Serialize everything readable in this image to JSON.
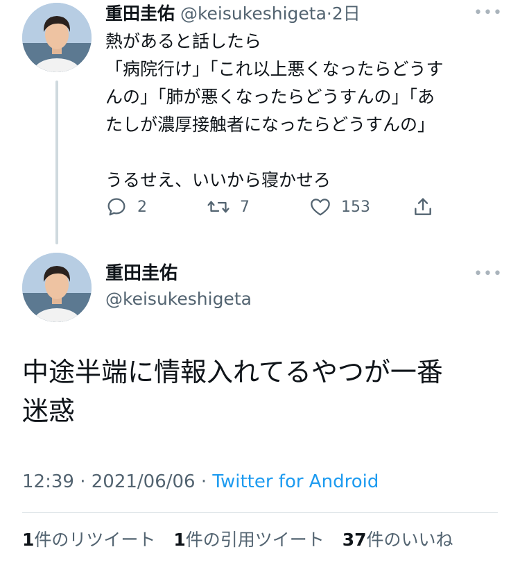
{
  "tweet1": {
    "author_name": "重田圭佑",
    "handle": "@keisukeshigeta",
    "separator": "·",
    "time_ago": "2日",
    "lines": [
      "熱があると話したら",
      "「病院行け」「これ以上悪くなったらどうす",
      "んの」「肺が悪くなったらどうすんの」「あ",
      "たしが濃厚接触者になったらどうすんの」",
      "",
      "うるせえ、いいから寝かせろ"
    ],
    "reply_count": "2",
    "retweet_count": "7",
    "like_count": "153",
    "icons": [
      "reply-icon",
      "retweet-icon",
      "like-icon",
      "share-icon",
      "more-icon"
    ]
  },
  "tweet2": {
    "author_name": "重田圭佑",
    "handle": "@keisukeshigeta",
    "lines": [
      "中途半端に情報入れてるやつが一番",
      "迷惑"
    ],
    "time": "12:39",
    "separator": "·",
    "date": "2021/06/06",
    "separator2": "·",
    "source": "Twitter for Android",
    "stats": {
      "retweets_num": "1",
      "retweets_label": "件のリツイート",
      "quotes_num": "1",
      "quotes_label": "件の引用ツイート",
      "likes_num": "37",
      "likes_label": "件のいいね"
    }
  },
  "colors": {
    "text": "#0f1419",
    "secondary": "#536471",
    "link": "#1d9bf0",
    "thread_line": "#cfd9de"
  }
}
